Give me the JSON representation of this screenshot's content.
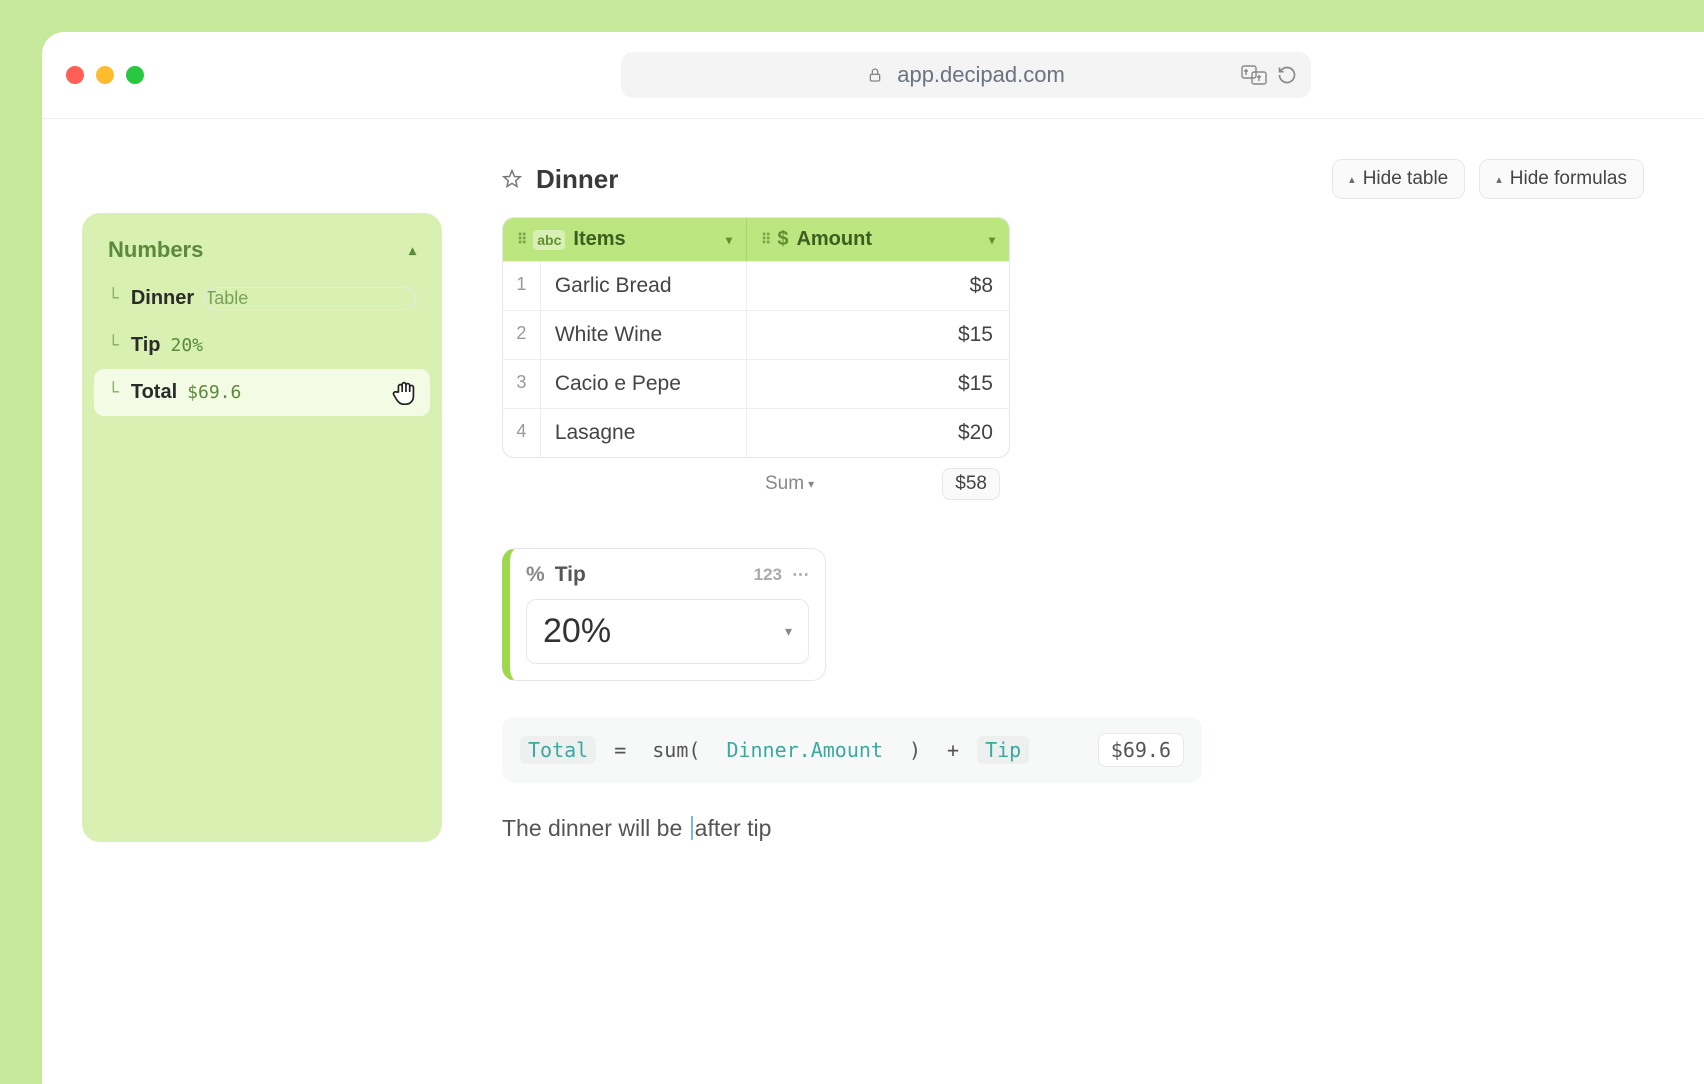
{
  "browser": {
    "url": "app.decipad.com"
  },
  "sidebar": {
    "title": "Numbers",
    "items": [
      {
        "name": "Dinner",
        "value": "Table"
      },
      {
        "name": "Tip",
        "value": "20%"
      },
      {
        "name": "Total",
        "value": "$69.6"
      }
    ]
  },
  "table": {
    "title": "Dinner",
    "hide_table_label": "Hide table",
    "hide_formulas_label": "Hide formulas",
    "col_items": "Items",
    "col_amount": "Amount",
    "type_label": "abc",
    "rows": [
      {
        "idx": "1",
        "item": "Garlic Bread",
        "amount": "$8"
      },
      {
        "idx": "2",
        "item": "White Wine",
        "amount": "$15"
      },
      {
        "idx": "3",
        "item": "Cacio e Pepe",
        "amount": "$15"
      },
      {
        "idx": "4",
        "item": "Lasagne",
        "amount": "$20"
      }
    ],
    "agg_label": "Sum",
    "agg_value": "$58"
  },
  "tip": {
    "label": "Tip",
    "hint": "123",
    "value": "20%"
  },
  "formula": {
    "var": "Total",
    "eq": "=",
    "fn": "sum(",
    "ref": "Dinner.Amount",
    "close": ")",
    "plus": "+",
    "tipref": "Tip",
    "result": "$69.6"
  },
  "sentence": {
    "before": "The dinner will be ",
    "after": "after tip"
  }
}
